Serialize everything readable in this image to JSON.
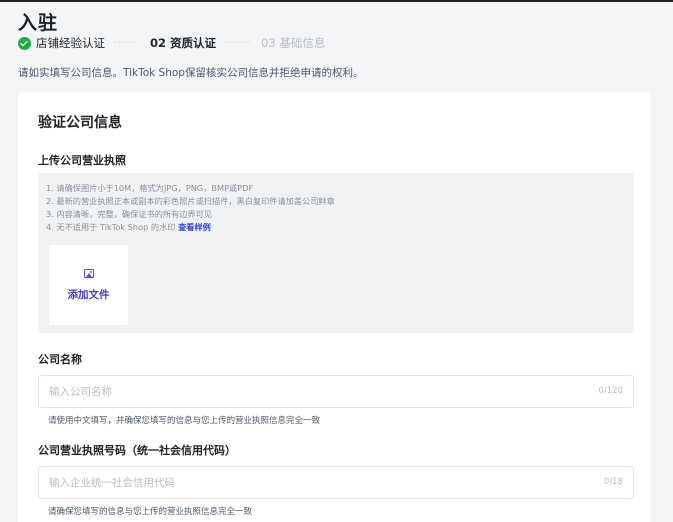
{
  "page": {
    "title": "入驻"
  },
  "steps": [
    {
      "label": "店铺经验认证",
      "status": "done"
    },
    {
      "label": "02 资质认证",
      "status": "current"
    },
    {
      "label": "03 基础信息",
      "status": "future"
    }
  ],
  "intro": "请如实填写公司信息。TikTok Shop保留核实公司信息并拒绝申请的权利。",
  "card": {
    "title": "验证公司信息",
    "license": {
      "label": "上传公司营业执照",
      "rules": [
        "1. 请确保图片小于10M，格式为JPG，PNG，BMP或PDF",
        "2. 最新的营业执照正本或副本的彩色照片或扫描件，黑白复印件请加盖公司鲜章",
        "3. 内容清晰，完整，确保证书的所有边界可见",
        "4. 无不适用于 TikTok Shop 的水印"
      ],
      "example_link": "查看样例",
      "upload_label": "添加文件"
    },
    "company_name": {
      "label": "公司名称",
      "placeholder": "输入公司名称",
      "counter": "0/120",
      "hint": "请使用中文填写，并确保您填写的信息与您上传的营业执照信息完全一致"
    },
    "license_number": {
      "label": "公司营业执照号码（统一社会信用代码）",
      "placeholder": "输入企业统一社会信用代码",
      "counter": "0/18",
      "hint": "请确保您填写的信息与您上传的营业执照信息完全一致"
    }
  },
  "colors": {
    "accent": "#4b3fc7",
    "success": "#22a84a",
    "link": "#3346d3"
  }
}
